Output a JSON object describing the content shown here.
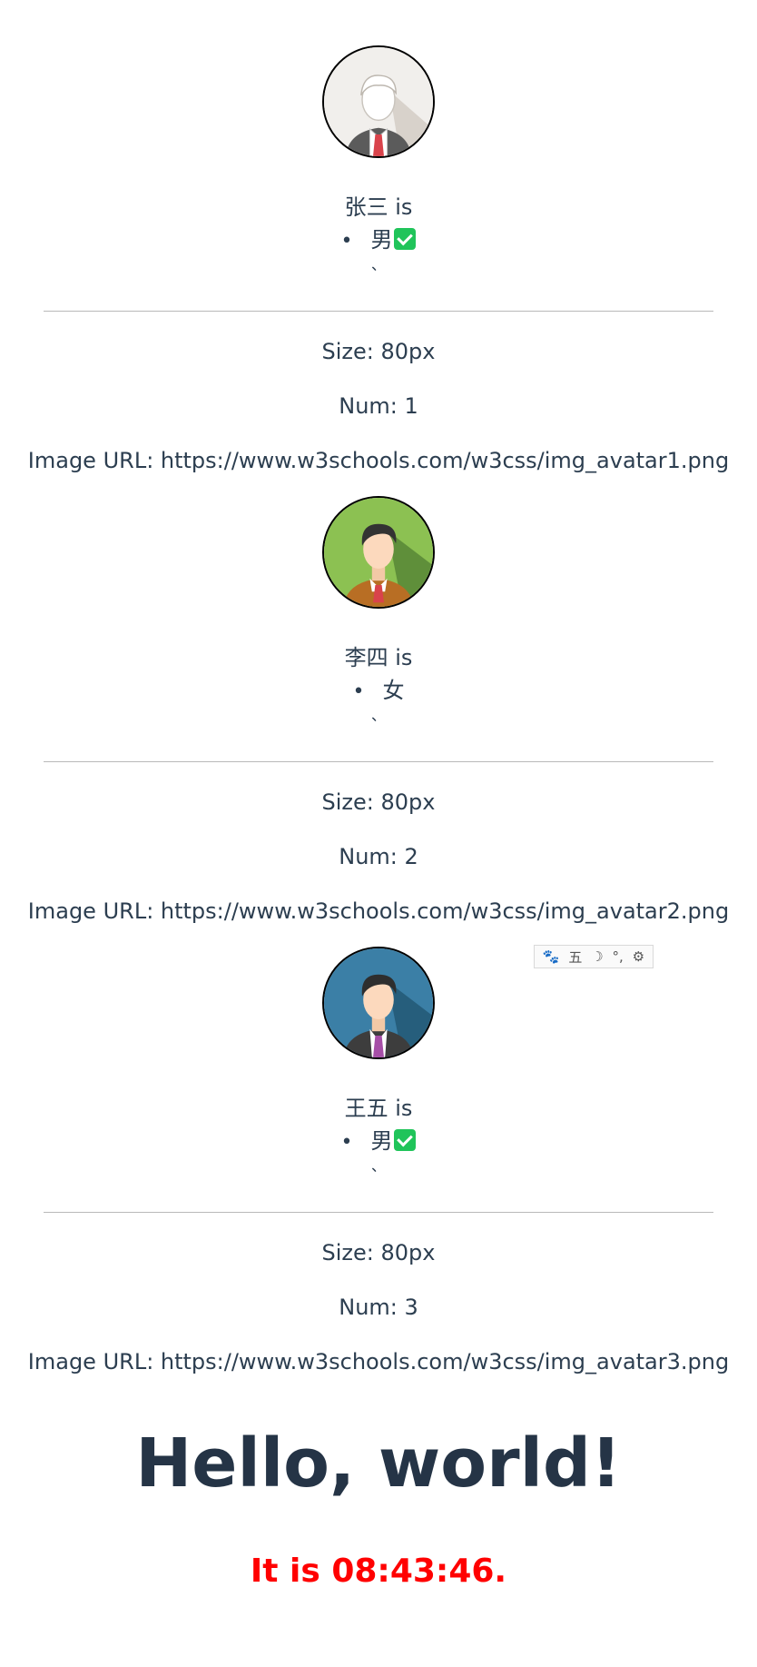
{
  "people": [
    {
      "name": "张三",
      "is_word": "is",
      "gender": "男",
      "gender_checked": true,
      "tick": "、",
      "size_text": "Size: 80px",
      "num_text": "Num: 1",
      "url_text": "Image URL: https://www.w3schools.com/w3css/img_avatar1.png",
      "avatar_icon": "avatar-grey-man-icon"
    },
    {
      "name": "李四",
      "is_word": "is",
      "gender": "女",
      "gender_checked": false,
      "tick": "、",
      "size_text": "Size: 80px",
      "num_text": "Num: 2",
      "url_text": "Image URL: https://www.w3schools.com/w3css/img_avatar2.png",
      "avatar_icon": "avatar-green-man-icon"
    },
    {
      "name": "王五",
      "is_word": "is",
      "gender": "男",
      "gender_checked": true,
      "tick": "、",
      "size_text": "Size: 80px",
      "num_text": "Num: 3",
      "url_text": "Image URL: https://www.w3schools.com/w3css/img_avatar3.png",
      "avatar_icon": "avatar-blue-man-icon"
    }
  ],
  "ime_toolbar": {
    "paw": "🐾",
    "mode": "五",
    "moon": "☽",
    "punct": "°,",
    "gear": "⚙"
  },
  "heading": "Hello, world!",
  "clock_text": "It is 08:43:46.",
  "colors": {
    "text": "#2c3e50",
    "clock": "#ff0000",
    "check": "#20c45a",
    "divider": "#b9b9b9"
  }
}
